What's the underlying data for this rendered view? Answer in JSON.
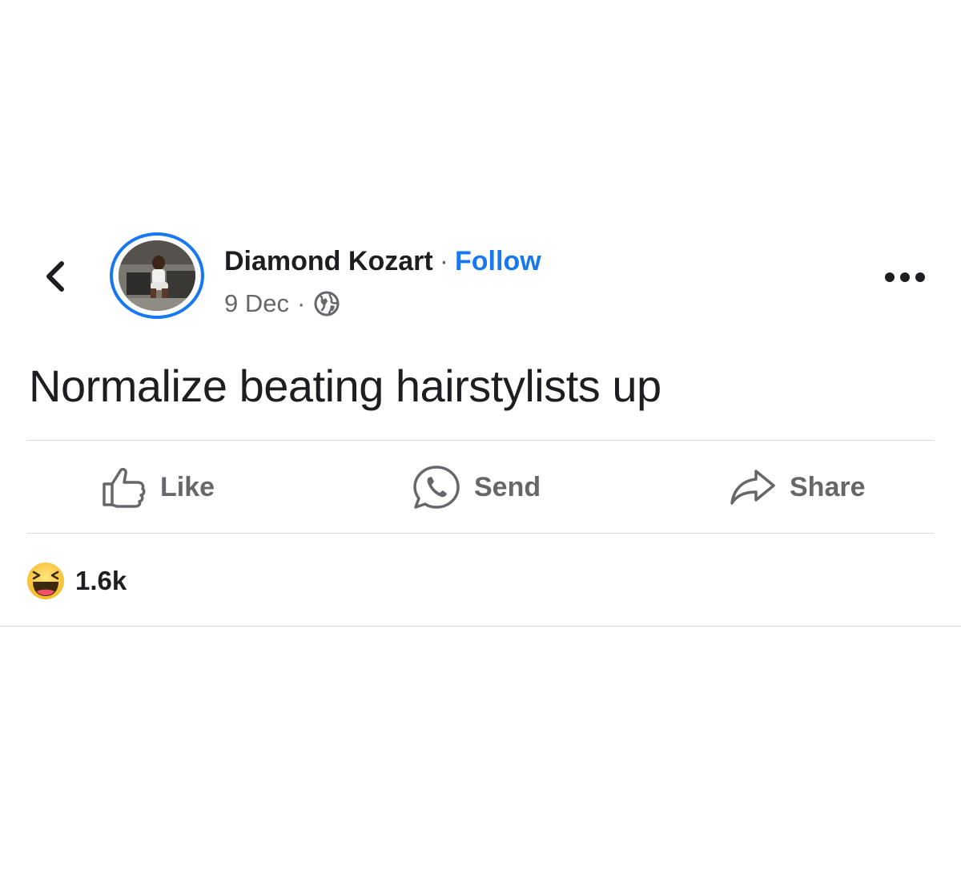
{
  "post": {
    "author": "Diamond Kozart",
    "separator": "·",
    "follow_label": "Follow",
    "date": "9 Dec",
    "privacy_icon": "globe-icon",
    "text": "Normalize beating hairstylists up"
  },
  "actions": {
    "like_label": "Like",
    "send_label": "Send",
    "share_label": "Share"
  },
  "reactions": {
    "icon": "laughing-emoji-icon",
    "count": "1.6k"
  },
  "colors": {
    "accent": "#1877f2",
    "secondary_text": "#65676b",
    "primary_text": "#1c1e21",
    "divider": "#d8d8d8"
  }
}
